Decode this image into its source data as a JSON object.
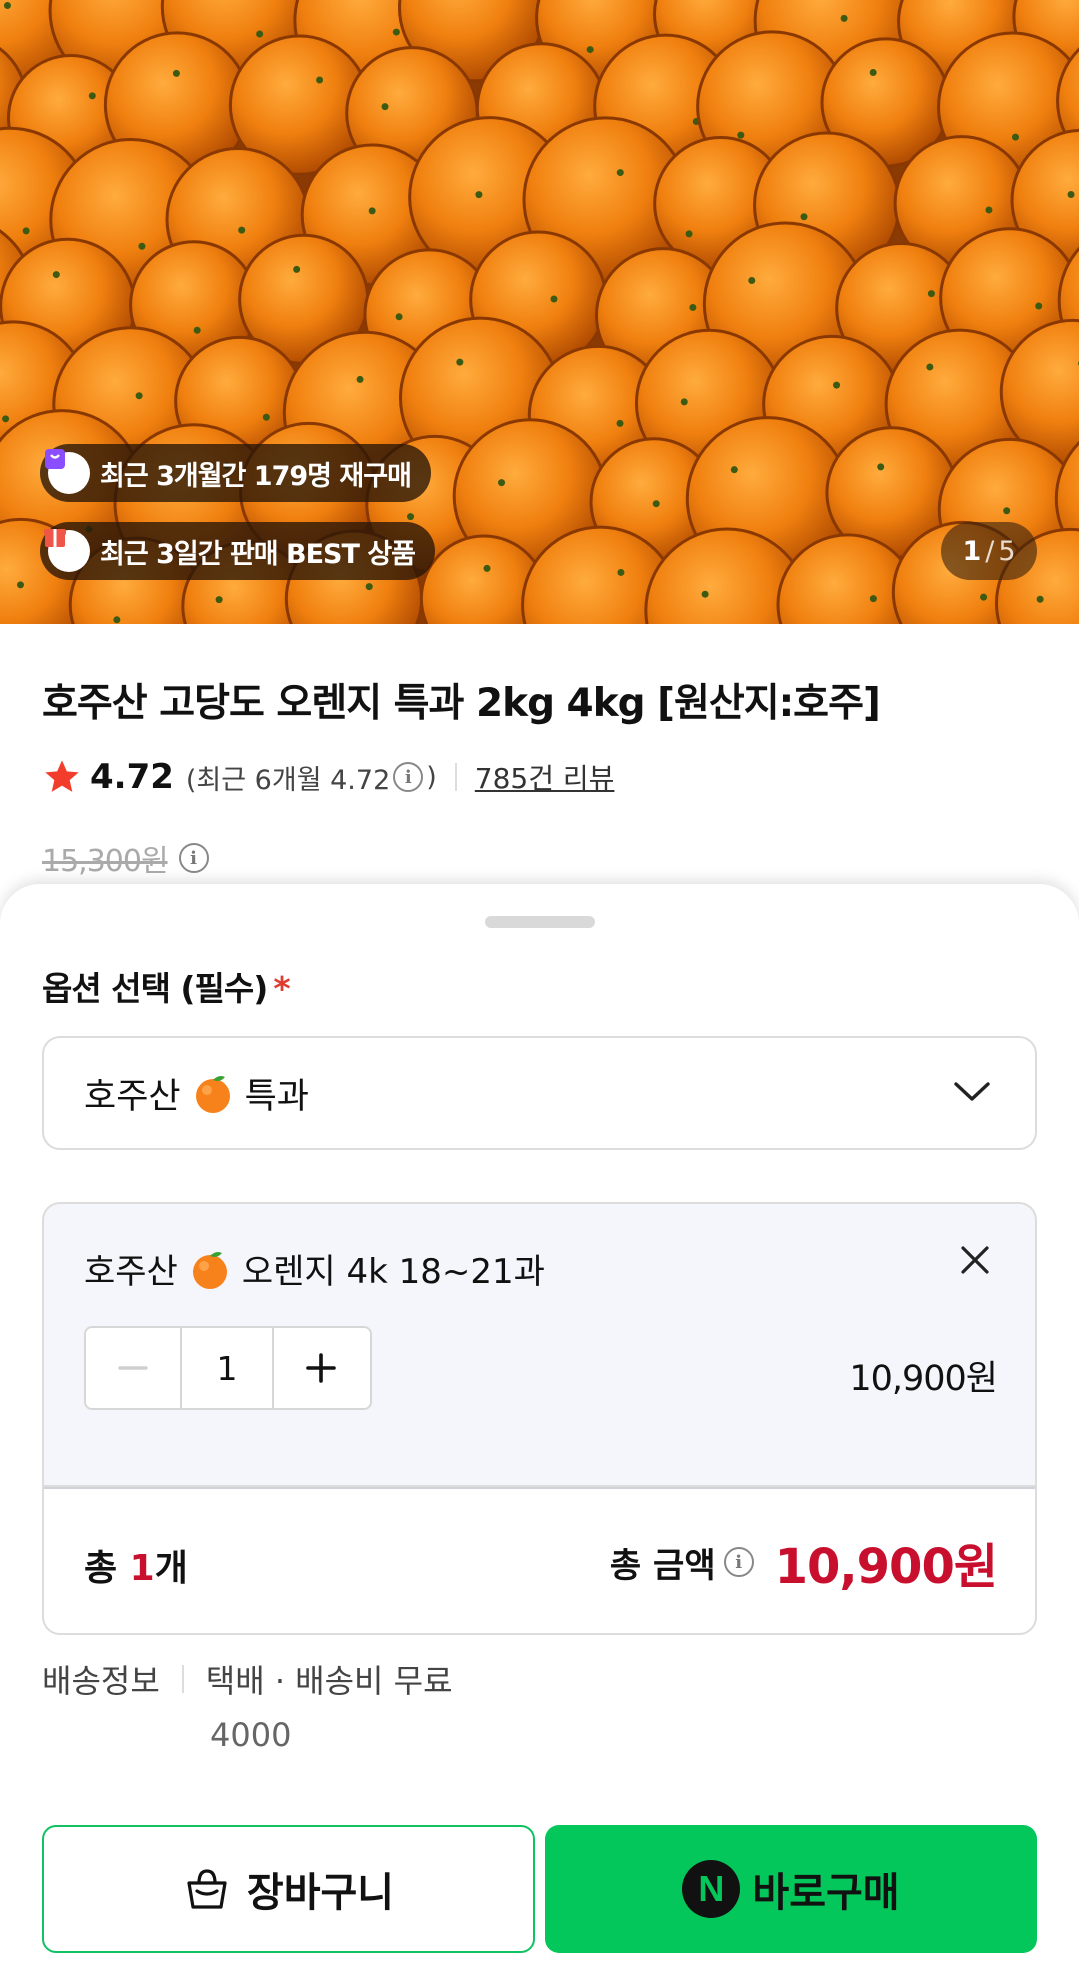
{
  "hero": {
    "badge_repurchase": "최근 3개월간 179명 재구매",
    "badge_best": "최근 3일간 판매 BEST 상품",
    "counter_current": "1",
    "counter_sep": "/",
    "counter_total": "5"
  },
  "product": {
    "title": "호주산 고당도 오렌지 특과 2kg 4kg [원산지:호주]",
    "rating": "4.72",
    "recent_open": "(최근 6개월 4.72",
    "recent_close": ")",
    "reviews": "785건 리뷰",
    "original_price": "15,300원"
  },
  "sheet": {
    "option_label": "옵션 선택 (필수)",
    "required_mark": "*",
    "select_prefix": "호주산",
    "select_suffix": "특과",
    "item_prefix": "호주산",
    "item_suffix": "오렌지 4k 18~21과",
    "quantity": "1",
    "item_price": "10,900원",
    "total_count_prefix": "총",
    "total_count_num": "1",
    "total_count_suffix": "개",
    "total_label": "총 금액",
    "total_amount": "10,900원",
    "shipping_label": "배송정보",
    "shipping_value": "택배 · 배송비 무료",
    "shipping_extra": "4000",
    "cart_button": "장바구니",
    "buy_button": "바로구매",
    "buy_logo": "N"
  },
  "colors": {
    "accent_red": "#c8102e",
    "naver_green": "#03c75a",
    "star": "#f23c2c"
  },
  "icons": [
    "bag-icon",
    "gift-icon",
    "star-icon",
    "info-icon",
    "chevron-down-icon",
    "tangerine-icon",
    "close-icon",
    "minus-icon",
    "plus-icon",
    "shopping-bag-icon",
    "naver-n-icon"
  ]
}
